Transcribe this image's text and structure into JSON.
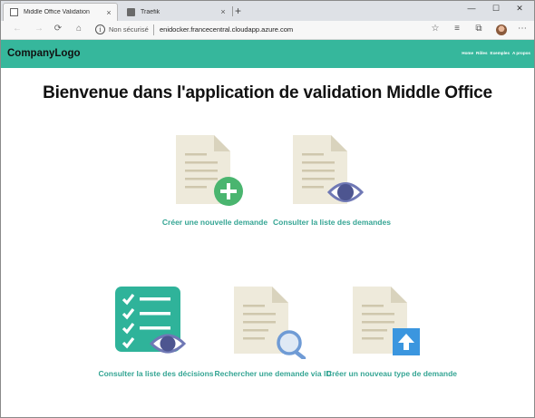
{
  "browser": {
    "tabs": [
      {
        "title": "Middle Office Validation",
        "active": true,
        "close": "×"
      },
      {
        "title": "Traefik",
        "active": false,
        "close": "×"
      }
    ],
    "new_tab": "+",
    "window_controls": {
      "minimize": "—",
      "maximize": "☐",
      "close": "✕"
    },
    "nav": {
      "back": "←",
      "forward": "→",
      "reload": "⟳",
      "home": "⌂"
    },
    "address": {
      "info": "i",
      "security_text": "Non sécurisé",
      "url": "enidocker.francecentral.cloudapp.azure.com"
    },
    "toolbar": {
      "favorite": "☆",
      "favorites_bar": "≡",
      "collections": "⧉",
      "menu": "⋯"
    }
  },
  "site": {
    "logo": "CompanyLogo",
    "nav": [
      "Home",
      "Rôles",
      "Exemples",
      "A propos"
    ],
    "heading": "Bienvenue dans l'application de validation Middle Office"
  },
  "tiles": [
    {
      "label": "Créer une nouvelle demande",
      "icon": "document-add-icon"
    },
    {
      "label": "Consulter la liste des demandes",
      "icon": "document-view-icon"
    },
    {
      "label": "Consulter la liste des décisions",
      "icon": "checklist-view-icon"
    },
    {
      "label": "Rechercher une demande via ID",
      "icon": "document-search-icon"
    },
    {
      "label": "Créer un nouveau type de demande",
      "icon": "document-upload-icon"
    }
  ],
  "colors": {
    "accent": "#36b79c",
    "link": "#35a594",
    "doc": "#eeeadb",
    "plus": "#4ab56f",
    "eye": "#5a66a8",
    "search": "#6f9bd5",
    "upload": "#3b96df"
  }
}
